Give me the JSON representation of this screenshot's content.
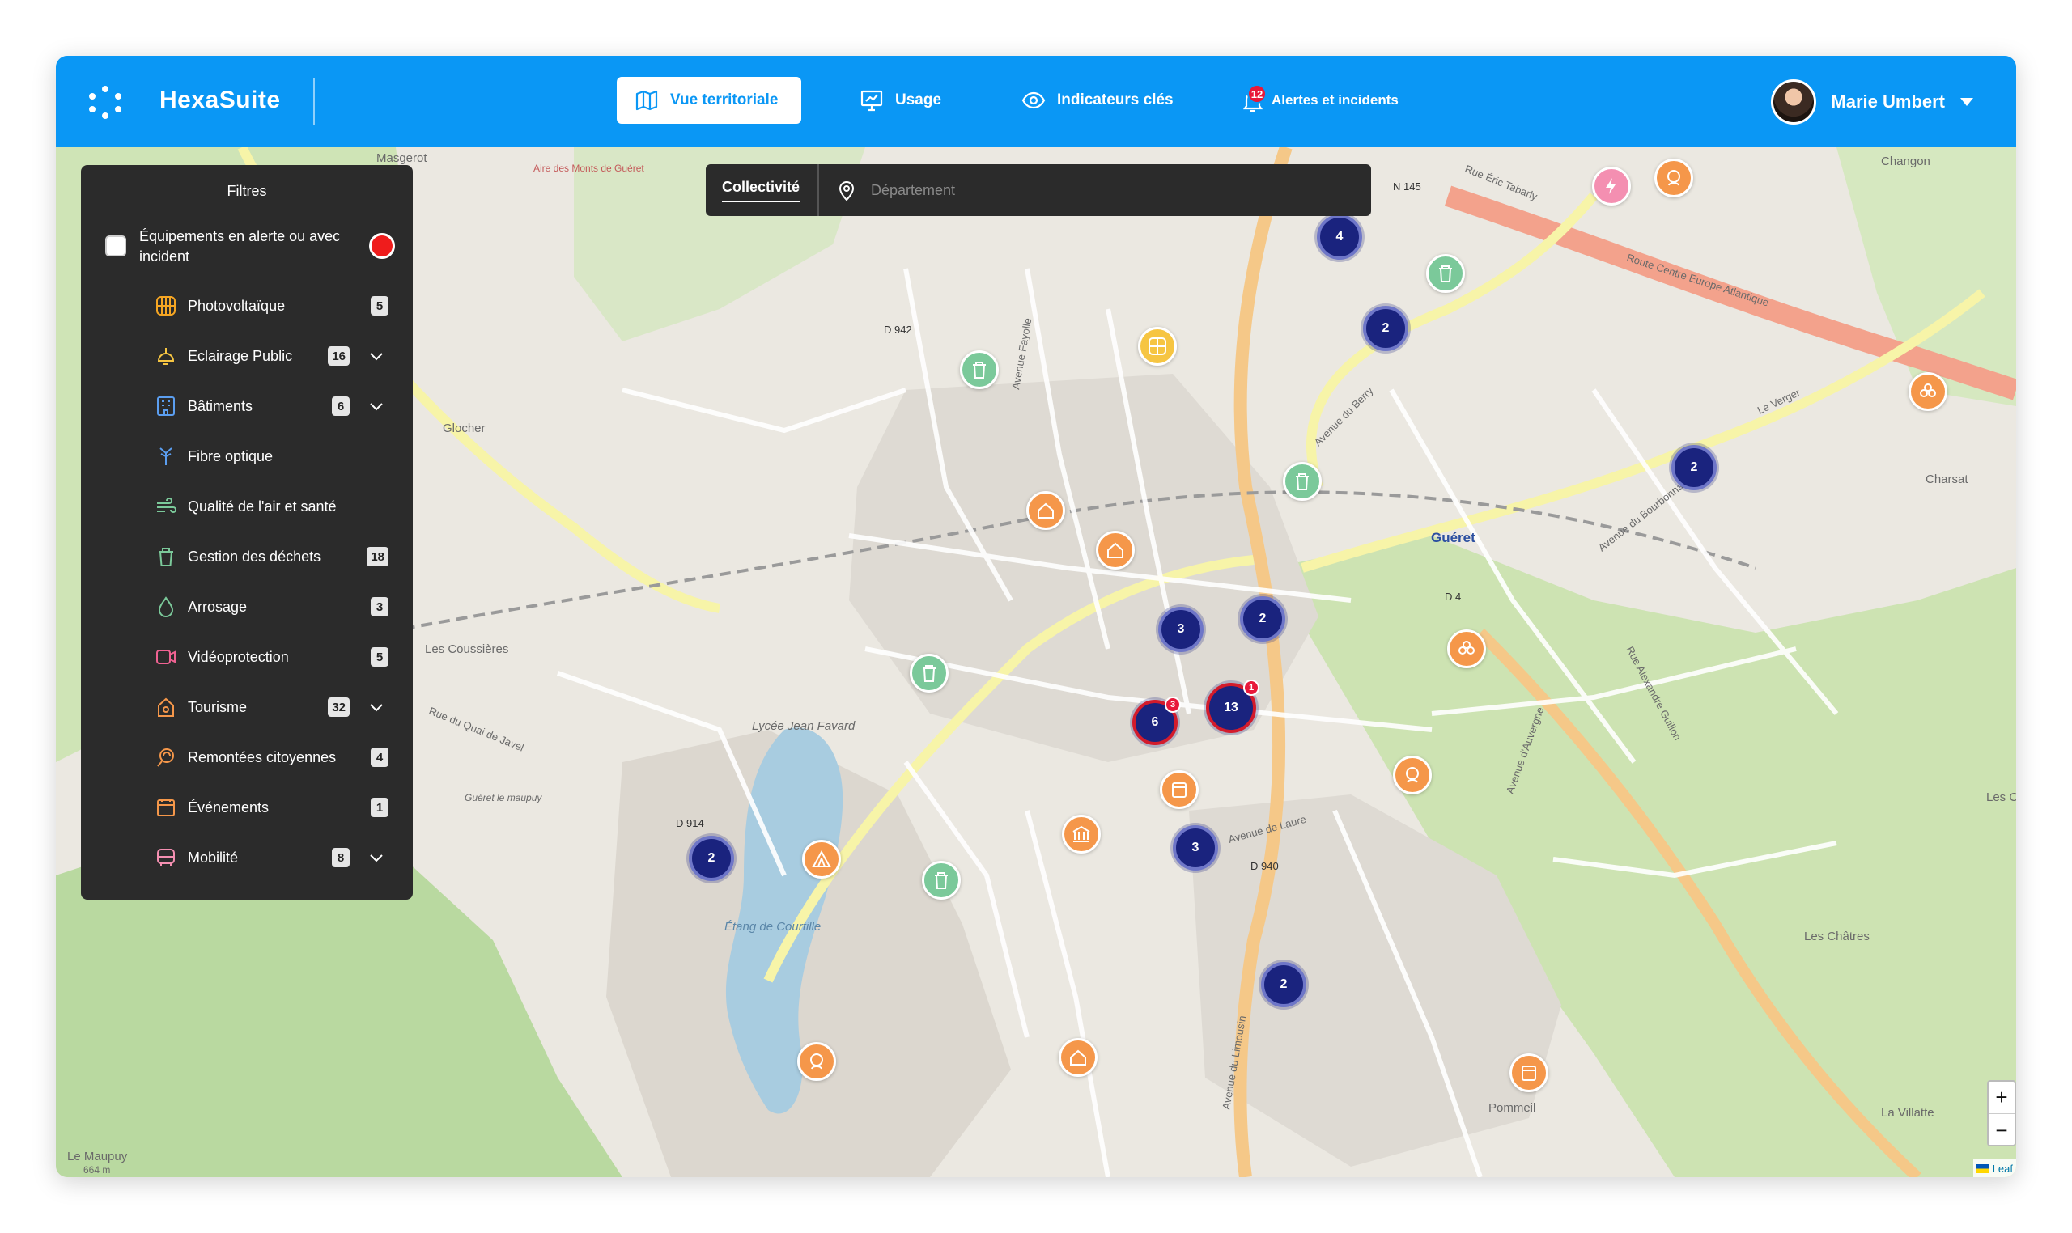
{
  "app": {
    "brand": "HexaSuite"
  },
  "nav": {
    "items": [
      {
        "label": "Vue territoriale",
        "icon": "map-icon"
      },
      {
        "label": "Usage",
        "icon": "usage-icon"
      },
      {
        "label": "Indicateurs clés",
        "icon": "eye-icon"
      },
      {
        "label": "Alertes et incidents",
        "icon": "bell-icon",
        "badge": "12"
      }
    ]
  },
  "user": {
    "name": "Marie Umbert"
  },
  "search": {
    "tab": "Collectivité",
    "placeholder": "Département"
  },
  "filters": {
    "title": "Filtres",
    "alert_label": "Équipements en alerte ou avec incident",
    "items": [
      {
        "label": "Photovoltaïque",
        "count": "5",
        "icon": "solar-panel-icon"
      },
      {
        "label": "Eclairage Public",
        "count": "16",
        "icon": "lamp-icon"
      },
      {
        "label": "Bâtiments",
        "count": "6",
        "icon": "building-icon"
      },
      {
        "label": "Fibre optique",
        "count": "",
        "icon": "fiber-icon"
      },
      {
        "label": "Qualité de l'air et santé",
        "count": "",
        "icon": "air-icon"
      },
      {
        "label": "Gestion des déchets",
        "count": "18",
        "icon": "trash-icon"
      },
      {
        "label": "Arrosage",
        "count": "3",
        "icon": "drop-icon"
      },
      {
        "label": "Vidéoprotection",
        "count": "5",
        "icon": "camera-icon"
      },
      {
        "label": "Tourisme",
        "count": "32",
        "icon": "tourism-icon"
      },
      {
        "label": "Remontées citoyennes",
        "count": "4",
        "icon": "citizen-icon"
      },
      {
        "label": "Événements",
        "count": "1",
        "icon": "calendar-icon"
      },
      {
        "label": "Mobilité",
        "count": "8",
        "icon": "bus-icon"
      }
    ]
  },
  "clusters": [
    "4",
    "2",
    "2",
    "3",
    "2",
    "6",
    "13",
    "3",
    "2",
    "2"
  ],
  "cluster_alerts": [
    "3",
    "1"
  ],
  "map": {
    "labels": [
      "Guéret",
      "Masgerot",
      "Glocher",
      "Les Coussières",
      "Charsat",
      "Les Châtres",
      "Pommeil",
      "La Villatte",
      "Changon",
      "Le Maupuy",
      "Étang de Courtille",
      "Lycée Jean Favard",
      "Avenue du Berry",
      "Avenue du Bourbonnais",
      "Route Centre Europe Atlantique",
      "Avenue d'Auvergne",
      "Avenue de Laure",
      "Rue du Quai de Javel",
      "Avenue du Limousin",
      "Le Verger",
      "N 145",
      "D 940",
      "D 942",
      "D 914",
      "D 4",
      "Les Chê",
      "Aire des Monts de Guéret",
      "Guéret le maupuy",
      "664 m",
      "Rue Éric Tabarly",
      "Avenue Fayolle",
      "Rue Alexandre Guillon"
    ],
    "attribution": "Leaf"
  },
  "zoom": {
    "in": "+",
    "out": "−"
  },
  "colors": {
    "header": "#0a97f5",
    "panel": "#2b2b2b",
    "cluster": "#1a237e",
    "alert": "#e8193a"
  }
}
